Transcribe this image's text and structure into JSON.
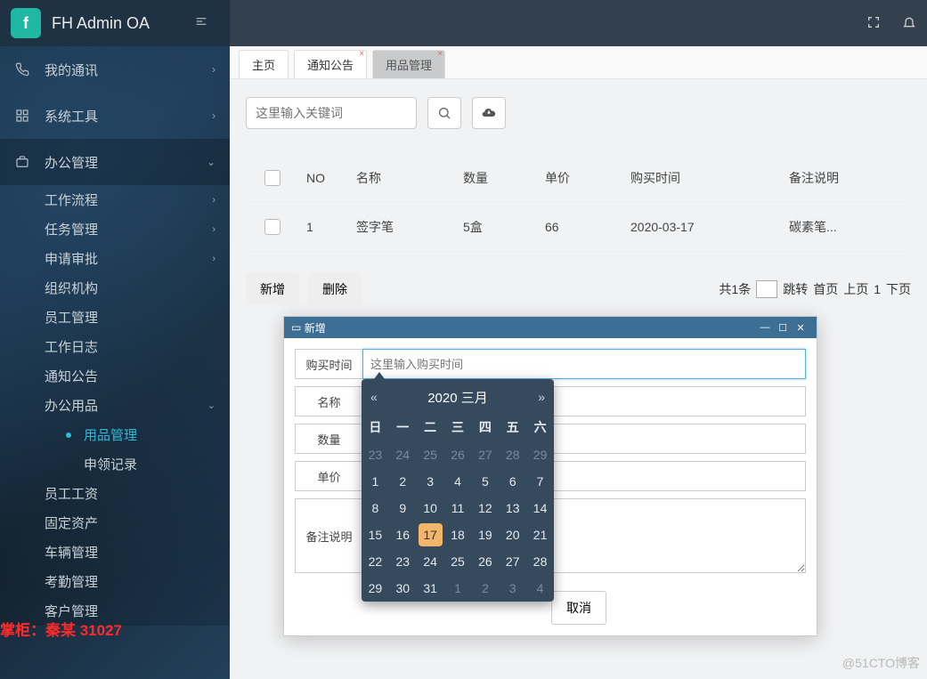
{
  "header": {
    "app_title": "FH Admin OA",
    "logo_glyph": "f"
  },
  "sidebar": {
    "items": [
      {
        "label": "我的通讯",
        "icon": "phone-icon"
      },
      {
        "label": "系统工具",
        "icon": "grid-icon"
      },
      {
        "label": "办公管理",
        "icon": "briefcase-icon"
      }
    ],
    "office_children": [
      {
        "label": "工作流程"
      },
      {
        "label": "任务管理"
      },
      {
        "label": "申请审批"
      },
      {
        "label": "组织机构"
      },
      {
        "label": "员工管理"
      },
      {
        "label": "工作日志"
      },
      {
        "label": "通知公告"
      },
      {
        "label": "办公用品"
      }
    ],
    "supply_children": [
      {
        "label": "用品管理",
        "active": true
      },
      {
        "label": "申领记录"
      }
    ],
    "tail": [
      {
        "label": "员工工资"
      },
      {
        "label": "固定资产"
      },
      {
        "label": "车辆管理"
      },
      {
        "label": "考勤管理"
      },
      {
        "label": "客户管理"
      }
    ]
  },
  "tabs": [
    {
      "label": "主页",
      "closable": false
    },
    {
      "label": "通知公告",
      "closable": true
    },
    {
      "label": "用品管理",
      "closable": true,
      "active": true
    }
  ],
  "search": {
    "placeholder": "这里输入关键词"
  },
  "table": {
    "headers": {
      "no": "NO",
      "name": "名称",
      "qty": "数量",
      "price": "单价",
      "date": "购买时间",
      "note": "备注说明"
    },
    "rows": [
      {
        "no": "1",
        "name": "签字笔",
        "qty": "5盒",
        "price": "66",
        "date": "2020-03-17",
        "note": "碳素笔..."
      }
    ]
  },
  "buttons": {
    "add": "新增",
    "delete": "删除",
    "cancel": "取消"
  },
  "pager": {
    "total": "共1条",
    "jump": "跳转",
    "first": "首页",
    "prev": "上页",
    "page": "1",
    "next": "下页"
  },
  "dialog": {
    "title": "新增",
    "fields": {
      "buy_time": {
        "label": "购买时间",
        "placeholder": "这里输入购买时间"
      },
      "name": {
        "label": "名称"
      },
      "qty": {
        "label": "数量"
      },
      "price": {
        "label": "单价"
      },
      "note": {
        "label": "备注说明"
      }
    }
  },
  "calendar": {
    "title": "2020 三月",
    "prev": "«",
    "next": "»",
    "dow": [
      "日",
      "一",
      "二",
      "三",
      "四",
      "五",
      "六"
    ],
    "weeks": [
      [
        {
          "d": "23",
          "o": 1
        },
        {
          "d": "24",
          "o": 1
        },
        {
          "d": "25",
          "o": 1
        },
        {
          "d": "26",
          "o": 1
        },
        {
          "d": "27",
          "o": 1
        },
        {
          "d": "28",
          "o": 1
        },
        {
          "d": "29",
          "o": 1
        }
      ],
      [
        {
          "d": "1"
        },
        {
          "d": "2"
        },
        {
          "d": "3"
        },
        {
          "d": "4"
        },
        {
          "d": "5"
        },
        {
          "d": "6"
        },
        {
          "d": "7"
        }
      ],
      [
        {
          "d": "8"
        },
        {
          "d": "9"
        },
        {
          "d": "10"
        },
        {
          "d": "11"
        },
        {
          "d": "12"
        },
        {
          "d": "13"
        },
        {
          "d": "14"
        }
      ],
      [
        {
          "d": "15"
        },
        {
          "d": "16"
        },
        {
          "d": "17",
          "sel": 1
        },
        {
          "d": "18"
        },
        {
          "d": "19"
        },
        {
          "d": "20"
        },
        {
          "d": "21"
        }
      ],
      [
        {
          "d": "22"
        },
        {
          "d": "23"
        },
        {
          "d": "24"
        },
        {
          "d": "25"
        },
        {
          "d": "26"
        },
        {
          "d": "27"
        },
        {
          "d": "28"
        }
      ],
      [
        {
          "d": "29"
        },
        {
          "d": "30"
        },
        {
          "d": "31"
        },
        {
          "d": "1",
          "o": 1
        },
        {
          "d": "2",
          "o": 1
        },
        {
          "d": "3",
          "o": 1
        },
        {
          "d": "4",
          "o": 1
        }
      ]
    ]
  },
  "watermark": {
    "red": "掌柜：秦某 31027",
    "corner": "@51CTO博客"
  }
}
